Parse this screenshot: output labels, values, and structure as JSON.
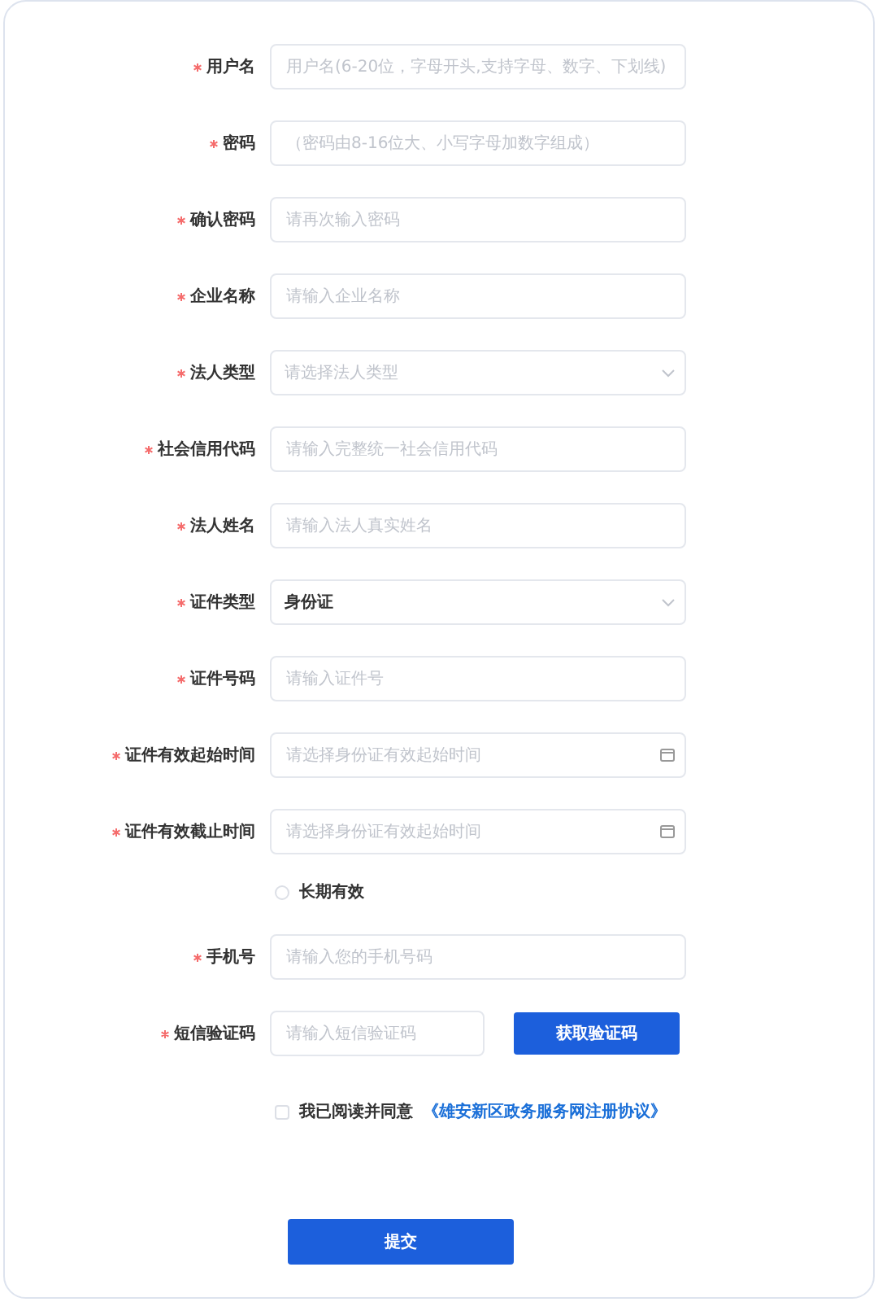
{
  "fields": [
    {
      "kind": "text",
      "label": "用户名",
      "required": true,
      "placeholder": "用户名(6-20位，字母开头,支持字母、数字、下划线)"
    },
    {
      "kind": "text",
      "label": "密码",
      "required": true,
      "placeholder": "（密码由8-16位大、小写字母加数字组成）"
    },
    {
      "kind": "text",
      "label": "确认密码",
      "required": true,
      "placeholder": "请再次输入密码"
    },
    {
      "kind": "text",
      "label": "企业名称",
      "required": true,
      "placeholder": "请输入企业名称"
    },
    {
      "kind": "select",
      "label": "法人类型",
      "required": true,
      "placeholder": "请选择法人类型"
    },
    {
      "kind": "text",
      "label": "社会信用代码",
      "required": true,
      "placeholder": "请输入完整统一社会信用代码"
    },
    {
      "kind": "text",
      "label": "法人姓名",
      "required": true,
      "placeholder": "请输入法人真实姓名"
    },
    {
      "kind": "select",
      "label": "证件类型",
      "required": true,
      "value": "身份证"
    },
    {
      "kind": "text",
      "label": "证件号码",
      "required": true,
      "placeholder": "请输入证件号"
    },
    {
      "kind": "date",
      "label": "证件有效起始时间",
      "required": true,
      "placeholder": "请选择身份证有效起始时间"
    },
    {
      "kind": "date",
      "label": "证件有效截止时间",
      "required": true,
      "placeholder": "请选择身份证有效起始时间"
    },
    {
      "kind": "radio",
      "label": "长期有效",
      "selected": false
    },
    {
      "kind": "text",
      "label": "手机号",
      "required": true,
      "placeholder": "请输入您的手机号码"
    },
    {
      "kind": "sms",
      "label": "短信验证码",
      "required": true,
      "placeholder": "请输入短信验证码",
      "button": "获取验证码"
    }
  ],
  "agreement": {
    "checked": false,
    "text": "我已阅读并同意",
    "link": "《雄安新区政务服务网注册协议》"
  },
  "submit": "提交"
}
